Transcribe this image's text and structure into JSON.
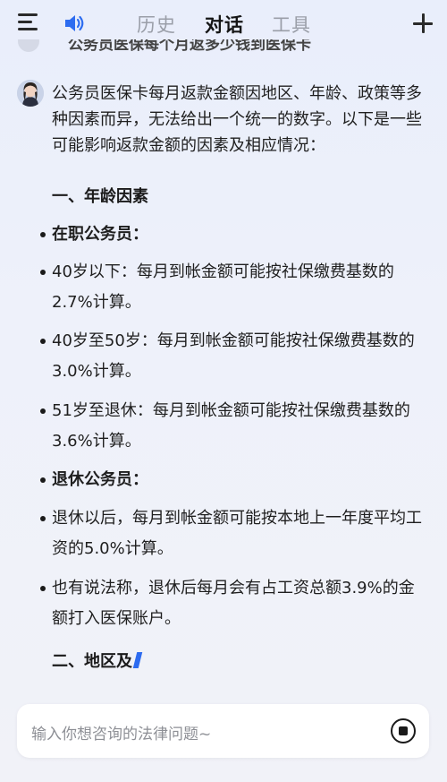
{
  "header": {
    "tabs": [
      {
        "label": "历史",
        "active": false
      },
      {
        "label": "对话",
        "active": true
      },
      {
        "label": "工具",
        "active": false
      }
    ],
    "icons": [
      "menu-icon",
      "speaker-icon",
      "plus-icon"
    ]
  },
  "previous_question": "公务员医保每个月返多少钱到医保卡",
  "answer": {
    "intro": "公务员医保卡每月返款金额因地区、年龄、政策等多种因素而异，无法给出一个统一的数字。以下是一些可能影响返款金额的因素及相应情况：",
    "section1_title": "一、年龄因素",
    "items": [
      {
        "text": "在职公务员：",
        "bold": true
      },
      {
        "text": "40岁以下：每月到帐金额可能按社保缴费基数的2.7%计算。",
        "bold": false
      },
      {
        "text": "40岁至50岁：每月到帐金额可能按社保缴费基数的3.0%计算。",
        "bold": false
      },
      {
        "text": "51岁至退休：每月到帐金额可能按社保缴费基数的3.6%计算。",
        "bold": false
      },
      {
        "text": "退休公务员：",
        "bold": true
      },
      {
        "text": "退休以后，每月到帐金额可能按本地上一年度平均工资的5.0%计算。",
        "bold": false
      },
      {
        "text": "也有说法称，退休后每月会有占工资总额3.9%的金额打入医保账户。",
        "bold": false
      }
    ],
    "section2_partial": "二、地区及"
  },
  "input": {
    "placeholder": "输入你想咨询的法律问题~"
  },
  "colors": {
    "accent": "#2d6cf0",
    "text": "#1f1f1f",
    "tab_inactive": "#9a9ea8"
  }
}
